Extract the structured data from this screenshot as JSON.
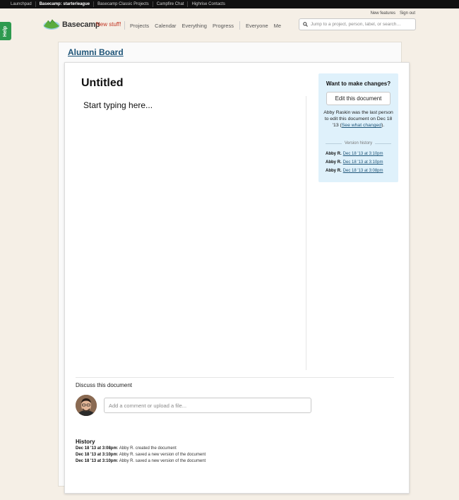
{
  "topbar": {
    "links": [
      "Launchpad",
      "Basecamp: starterleague",
      "Basecamp Classic Projects",
      "Campfire Chat",
      "Highrise Contacts"
    ],
    "current_index": 1
  },
  "help": {
    "label": "Help"
  },
  "account": {
    "new_features": "New features",
    "sign_out": "Sign out"
  },
  "brand": {
    "name": "Basecamp",
    "new_stuff": "New stuff!"
  },
  "nav": {
    "items": [
      "Projects",
      "Calendar",
      "Everything",
      "Progress",
      "Everyone",
      "Me"
    ]
  },
  "search": {
    "placeholder": "Jump to a project, person, label, or search…"
  },
  "project": {
    "title": "Alumni Board"
  },
  "document": {
    "title": "Untitled",
    "body_placeholder": "Start typing here..."
  },
  "panel": {
    "heading": "Want to make changes?",
    "edit_button": "Edit this document",
    "last_edit_prefix": "Abby Raskin was the last person to edit this document on Dec 18 '13 (",
    "last_edit_link": "See what changed",
    "last_edit_suffix": ").",
    "version_history_label": "Version history",
    "versions": [
      {
        "author": "Abby R.",
        "link": "Dec 18 '13 at 3:10pm"
      },
      {
        "author": "Abby R.",
        "link": "Dec 18 '13 at 3:10pm"
      },
      {
        "author": "Abby R.",
        "link": "Dec 18 '13 at 3:08pm"
      }
    ]
  },
  "discussion": {
    "label": "Discuss this document",
    "comment_placeholder": "Add a comment or upload a file..."
  },
  "history": {
    "title": "History",
    "items": [
      {
        "time": "Dec 18 '13 at 3:08pm",
        "text": ": Abby R. created the document"
      },
      {
        "time": "Dec 18 '13 at 3:10pm",
        "text": ": Abby R. saved a new version of the document"
      },
      {
        "time": "Dec 18 '13 at 3:10pm",
        "text": ": Abby R. saved a new version of the document"
      }
    ]
  },
  "colors": {
    "background": "#f5efe6",
    "topbar": "#111111",
    "help_tab": "#2e9a4f",
    "new_stuff": "#c0321f",
    "link": "#1d5478",
    "panel": "#dff1fb"
  },
  "icons": {
    "logo": "basecamp-logo",
    "search": "search-icon"
  }
}
